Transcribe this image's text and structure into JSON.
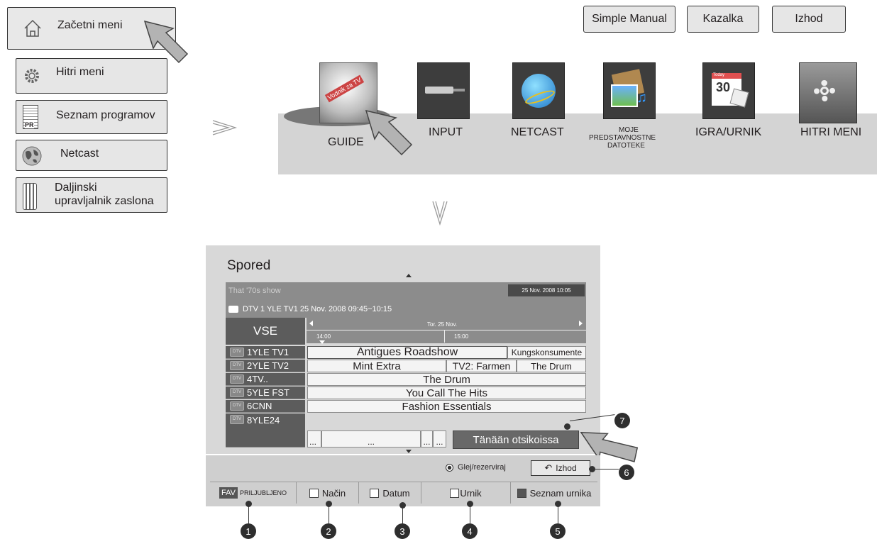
{
  "left_menu": {
    "items": [
      {
        "label": "Začetni meni",
        "icon": "home-icon"
      },
      {
        "label": "Hitri meni",
        "icon": "gear-icon"
      },
      {
        "label": "Seznam programov",
        "icon": "program-list-icon",
        "icon_text": "PR"
      },
      {
        "label": "Netcast",
        "icon": "globe-icon"
      },
      {
        "label_line1": "Daljinski",
        "label_line2": "upravljalnik zaslona",
        "icon": "remote-icon"
      }
    ]
  },
  "top_buttons": {
    "simple_manual": "Simple Manual",
    "remote": "Kazalka",
    "exit": "Izhod"
  },
  "home_strip": {
    "items": [
      {
        "label": "GUIDE",
        "icon": "guide-icon",
        "icon_text": "Vodnik za TV"
      },
      {
        "label": "INPUT",
        "icon": "input-icon"
      },
      {
        "label": "NETCAST",
        "icon": "netcast-globe-icon"
      },
      {
        "label_l1": "MOJE",
        "label_l2": "PREDSTAVNOSTNE",
        "label_l3": "DATOTEKE",
        "icon": "media-icon"
      },
      {
        "label": "IGRA/URNIK",
        "icon": "calendar-icon",
        "icon_text": "30",
        "icon_text_top": "Today"
      },
      {
        "label": "HITRI MENI",
        "icon": "gear-icon"
      }
    ]
  },
  "guide": {
    "title": "Spored",
    "program_title": "That '70s show",
    "current_datetime": "25 Nov. 2008 10:05",
    "channel_info": "DTV 1 YLE TV1 25 Nov. 2008 09:45~10:15",
    "all_label": "VSE",
    "date_label": "Tor. 25 Nov.",
    "time1": "14:00",
    "time2": "15:00",
    "dtv_badge": "DTV",
    "channels": [
      "1YLE TV1",
      "2YLE TV2",
      "4TV..",
      "5YLE FST",
      "6CNN",
      "8YLE24"
    ],
    "row1": [
      "Antigues Roadshow",
      "Kungskonsumente"
    ],
    "row2": [
      "Mint Extra",
      "TV2: Farmen",
      "The Drum"
    ],
    "row3": [
      "The Drum"
    ],
    "row4": [
      "You Call The Hits"
    ],
    "row5": [
      "Fashion Essentials"
    ],
    "row6": [
      "...",
      "...",
      "...",
      "...",
      "Tänään otsikoissa"
    ],
    "watch_reserve": "Glej/rezerviraj",
    "exit": "Izhod",
    "tabs": {
      "fav_badge": "FAV",
      "fav": "PRILJUBLJENO",
      "mode": "Način",
      "date": "Datum",
      "schedule": "Urnik",
      "schedule_list": "Seznam urnika"
    }
  },
  "callouts": [
    "1",
    "2",
    "3",
    "4",
    "5",
    "6",
    "7"
  ]
}
